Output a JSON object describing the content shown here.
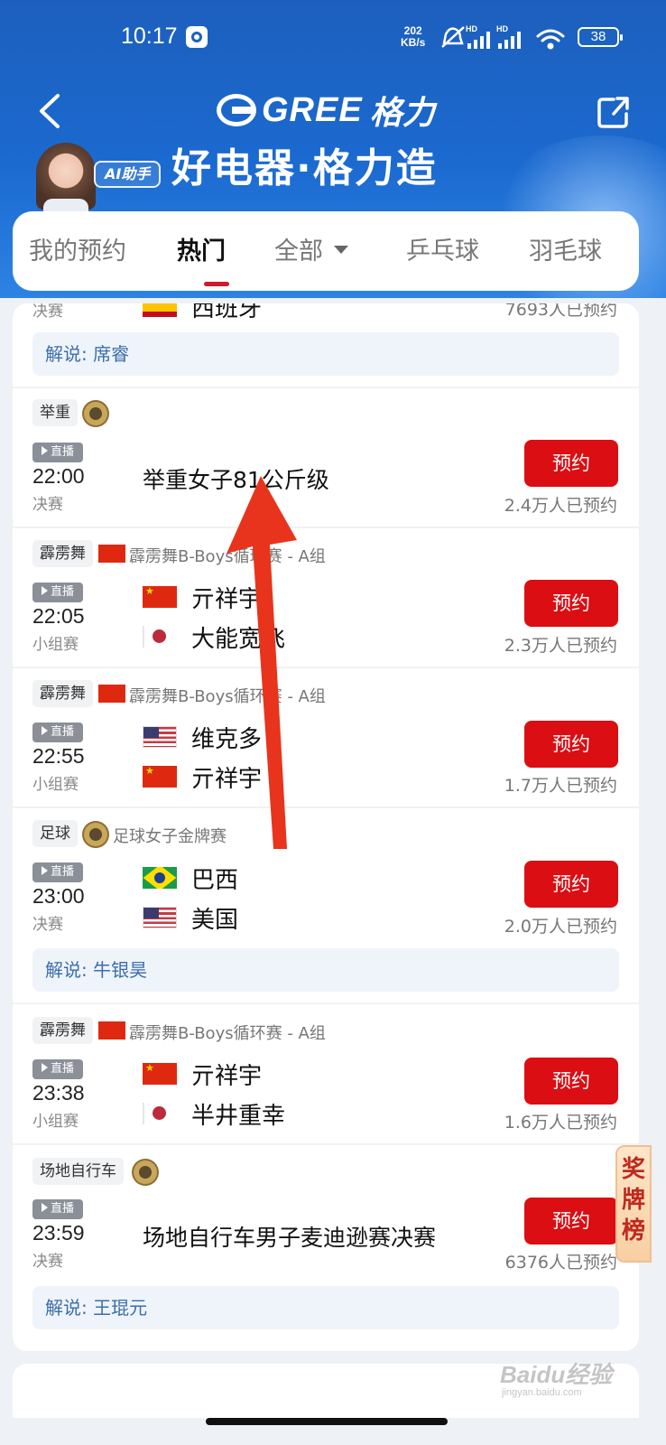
{
  "status_bar": {
    "time": "10:17",
    "speed_value": "202",
    "speed_unit": "KB/s",
    "signal_label_1": "HD",
    "signal_label_2": "HD",
    "battery": "38"
  },
  "header": {
    "brand_en": "GREE",
    "brand_cn": "格力",
    "slogan": "好电器·格力造",
    "ai_badge": "AI助手"
  },
  "tabs": [
    {
      "label": "我的预约"
    },
    {
      "label": "热门"
    },
    {
      "label": "全部"
    },
    {
      "label": "乒乓球"
    },
    {
      "label": "羽毛球"
    }
  ],
  "partial_top": {
    "stage": "决赛",
    "team": "西班牙",
    "count": "7693人已预约",
    "commentary": "解说: 席睿"
  },
  "events": [
    {
      "tag": "举重",
      "time": "22:00",
      "stage": "决赛",
      "title": "举重女子81公斤级",
      "count": "2.4万人已预约",
      "button": "预约",
      "live": "直播"
    },
    {
      "tag": "霹雳舞",
      "sub": "霹雳舞B-Boys循环赛 - A组",
      "time": "22:05",
      "stage": "小组赛",
      "team1": "亓祥宇",
      "team2": "大能宽飞",
      "count": "2.3万人已预约",
      "button": "预约",
      "live": "直播"
    },
    {
      "tag": "霹雳舞",
      "sub": "霹雳舞B-Boys循环赛 - A组",
      "time": "22:55",
      "stage": "小组赛",
      "team1": "维克多",
      "team2": "亓祥宇",
      "count": "1.7万人已预约",
      "button": "预约",
      "live": "直播"
    },
    {
      "tag": "足球",
      "sub": "足球女子金牌赛",
      "time": "23:00",
      "stage": "决赛",
      "team1": "巴西",
      "team2": "美国",
      "count": "2.0万人已预约",
      "button": "预约",
      "live": "直播",
      "commentary": "解说: 牛银昊"
    },
    {
      "tag": "霹雳舞",
      "sub": "霹雳舞B-Boys循环赛 - A组",
      "time": "23:38",
      "stage": "小组赛",
      "team1": "亓祥宇",
      "team2": "半井重幸",
      "count": "1.6万人已预约",
      "button": "预约",
      "live": "直播"
    },
    {
      "tag": "场地自行车",
      "time": "23:59",
      "stage": "决赛",
      "title": "场地自行车男子麦迪逊赛决赛",
      "count": "6376人已预约",
      "button": "预约",
      "live": "直播",
      "commentary": "解说: 王琨元"
    }
  ],
  "side_tab": {
    "label": "奖牌榜"
  },
  "watermark": {
    "main": "Baidu经验",
    "sub": "jingyan.baidu.com"
  },
  "colors": {
    "header_blue": "#1b6ad0",
    "accent_red": "#db0e13",
    "commentary_text": "#3c6ea8"
  }
}
